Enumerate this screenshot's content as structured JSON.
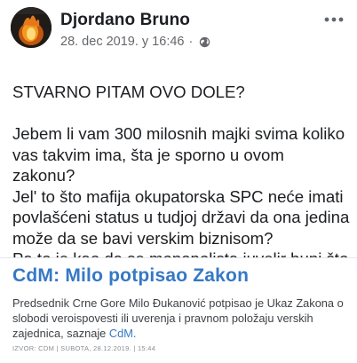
{
  "post": {
    "author": "Djordano Bruno",
    "timestamp": "28. dec 2019. у 16:46",
    "separator": "·",
    "privacy_icon": "globe-icon",
    "more_icon": "more-options-icon",
    "avatar_icon": "profile-avatar"
  },
  "body": {
    "line1": "STVARNO PITAM OVO DOLE?",
    "line2": "Jebem li vam 300 milosnih majki svima koliko vas takvim ima, šta je sporno u ovom zakonu?",
    "line3": "Jel' to što mafija okupatorska SPC neće imati povlašćeni status u tudjoj državi da ona jedina može da se bavi verskim biznisom?",
    "line4": "Pa to je kao da se monopolista juvelir buni što još neko drži takvu radnju"
  },
  "link_preview": {
    "title": "CdM: Milo potpisao Zakon",
    "description": "Predsednik Crne Gore Milo Đukanović potpisao je Ukaz Zakona o slobodi veroispovesti ili uverenja i pravnom položaju verskih zajednica, saznaje",
    "source_inline": "CdM.",
    "footer": "IZVOR: CDM | SUBOTA, 28.12.2019. | 15:44"
  },
  "colors": {
    "link_blue": "#3578c6",
    "meta_gray": "#65676b",
    "text": "#1c1e21"
  }
}
